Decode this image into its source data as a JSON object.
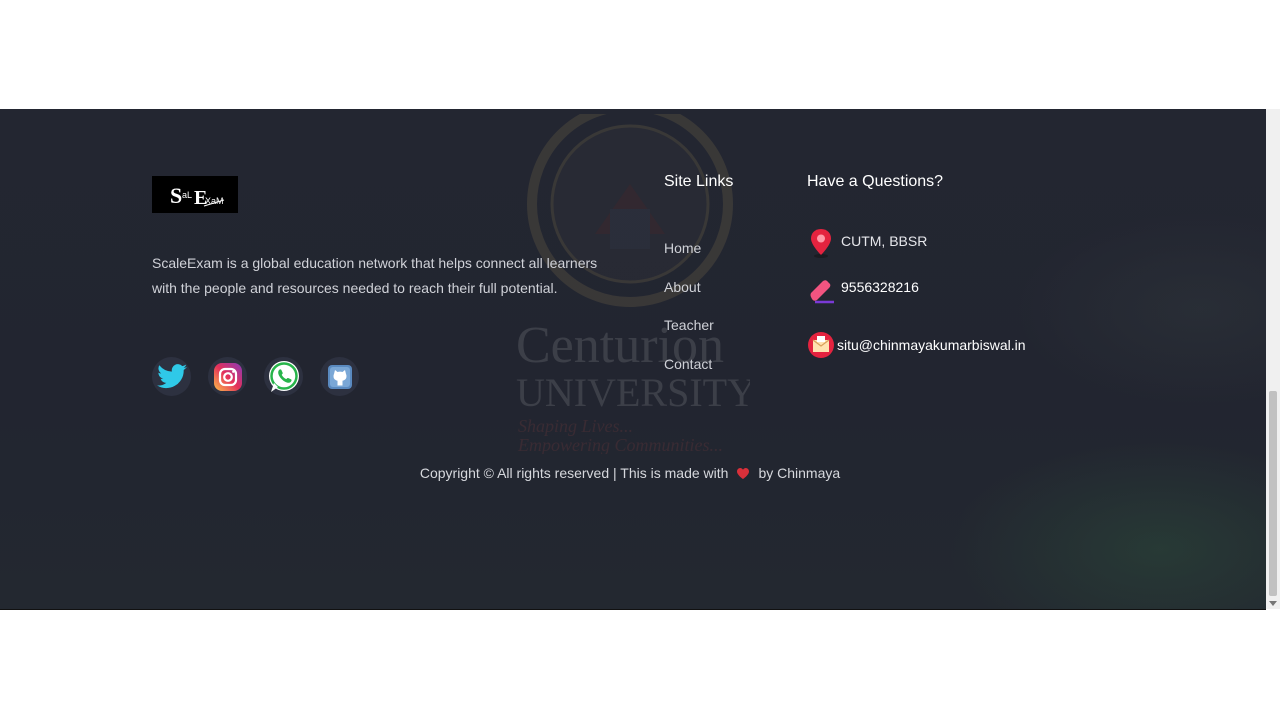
{
  "brand": {
    "logo_text": "SaLEXaM"
  },
  "footer": {
    "description": "ScaleExam is a global education network that helps connect all learners with the people and resources needed to reach their full potential.",
    "social": [
      "twitter-icon",
      "instagram-icon",
      "whatsapp-icon",
      "github-icon"
    ],
    "site_links": {
      "title": "Site Links",
      "items": [
        {
          "label": "Home"
        },
        {
          "label": "About"
        },
        {
          "label": "Teacher"
        },
        {
          "label": "Contact"
        }
      ]
    },
    "questions": {
      "title": "Have a Questions?",
      "address": "CUTM, BBSR",
      "phone": "9556328216",
      "email": "situ@chinmayakumarbiswal.in"
    },
    "copyright_prefix": "Copyright © All rights reserved | This is made with",
    "copyright_suffix": "by Chinmaya"
  },
  "watermark": {
    "line1": "Centurion",
    "line2": "UNIVERSITY",
    "line3": "Shaping Lives...",
    "line4": "Empowering Communities..."
  },
  "colors": {
    "footer_bg": "#232631",
    "heart": "#d9303a",
    "link_text": "#cfd1d7"
  }
}
